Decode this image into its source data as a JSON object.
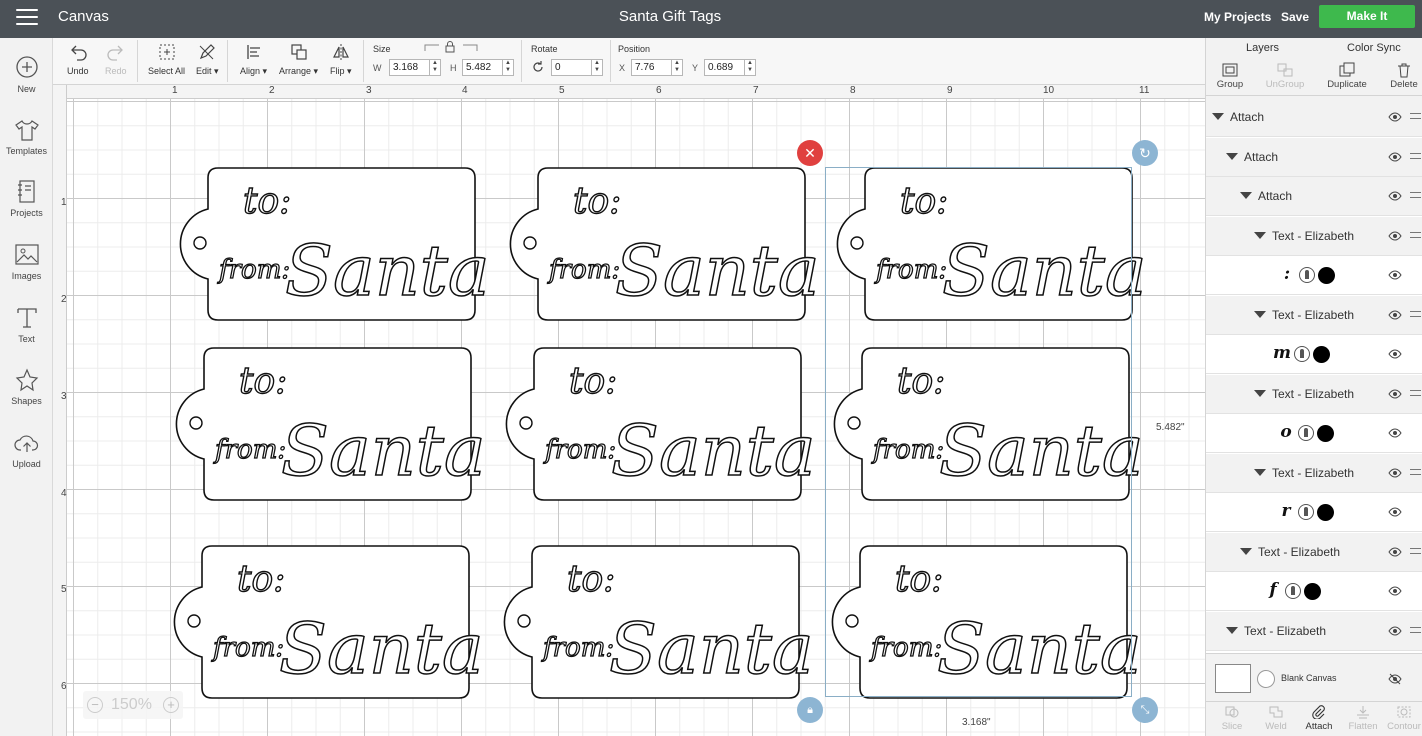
{
  "topbar": {
    "app_title": "Canvas",
    "project_title": "Santa Gift Tags",
    "my_projects": "My Projects",
    "save": "Save",
    "make_it": "Make It"
  },
  "left_sidebar": [
    {
      "label": "New",
      "icon": "plus-circle-icon"
    },
    {
      "label": "Templates",
      "icon": "tshirt-icon"
    },
    {
      "label": "Projects",
      "icon": "notebook-icon"
    },
    {
      "label": "Images",
      "icon": "image-icon"
    },
    {
      "label": "Text",
      "icon": "text-t-icon"
    },
    {
      "label": "Shapes",
      "icon": "shapes-icon"
    },
    {
      "label": "Upload",
      "icon": "cloud-upload-icon"
    }
  ],
  "toolbar": {
    "undo": "Undo",
    "redo": "Redo",
    "select_all": "Select All",
    "edit": "Edit",
    "align": "Align",
    "arrange": "Arrange",
    "flip": "Flip",
    "size_label": "Size",
    "w_label": "W",
    "w_value": "3.168",
    "h_label": "H",
    "h_value": "5.482",
    "rotate_label": "Rotate",
    "rotate_value": "0",
    "position_label": "Position",
    "x_label": "X",
    "x_value": "7.76",
    "y_label": "Y",
    "y_value": "0.689"
  },
  "canvas": {
    "ruler_top": [
      "1",
      "2",
      "3",
      "4",
      "5",
      "6",
      "7",
      "8",
      "9",
      "10",
      "11"
    ],
    "ruler_left": [
      "1",
      "2",
      "3",
      "4",
      "5",
      "6"
    ],
    "tag": {
      "to": "to:",
      "from": "from:",
      "name": "Santa"
    },
    "height_label": "5.482\"",
    "width_label": "3.168\"",
    "zoom": "150%",
    "zoom_minus": "−",
    "zoom_plus": "+"
  },
  "right_panel": {
    "tab_layers": "Layers",
    "tab_color_sync": "Color Sync",
    "tools": [
      {
        "label": "Group",
        "enabled": true
      },
      {
        "label": "UnGroup",
        "enabled": false
      },
      {
        "label": "Duplicate",
        "enabled": true
      },
      {
        "label": "Delete",
        "enabled": true
      }
    ],
    "layers": [
      {
        "type": "group",
        "label": "Attach"
      },
      {
        "type": "group",
        "label": "Attach"
      },
      {
        "type": "group",
        "label": "Attach"
      },
      {
        "type": "group",
        "label": "Text - Elizabeth"
      },
      {
        "type": "item",
        "glyph": ":"
      },
      {
        "type": "group",
        "label": "Text - Elizabeth"
      },
      {
        "type": "item",
        "glyph": "m"
      },
      {
        "type": "group",
        "label": "Text - Elizabeth"
      },
      {
        "type": "item",
        "glyph": "o"
      },
      {
        "type": "group",
        "label": "Text - Elizabeth"
      },
      {
        "type": "item",
        "glyph": "r"
      },
      {
        "type": "group",
        "label": "Text - Elizabeth"
      },
      {
        "type": "item",
        "glyph": "f"
      },
      {
        "type": "group",
        "label": "Text - Elizabeth"
      }
    ],
    "blank_canvas": "Blank Canvas",
    "bottom_tools": [
      {
        "label": "Slice",
        "enabled": false
      },
      {
        "label": "Weld",
        "enabled": false
      },
      {
        "label": "Attach",
        "enabled": true
      },
      {
        "label": "Flatten",
        "enabled": false
      },
      {
        "label": "Contour",
        "enabled": false
      }
    ]
  },
  "colors": {
    "topbar": "#4b5157",
    "make_it": "#3eb94d",
    "delete_handle": "#e0403f",
    "selection_handle": "#8db5d3"
  }
}
